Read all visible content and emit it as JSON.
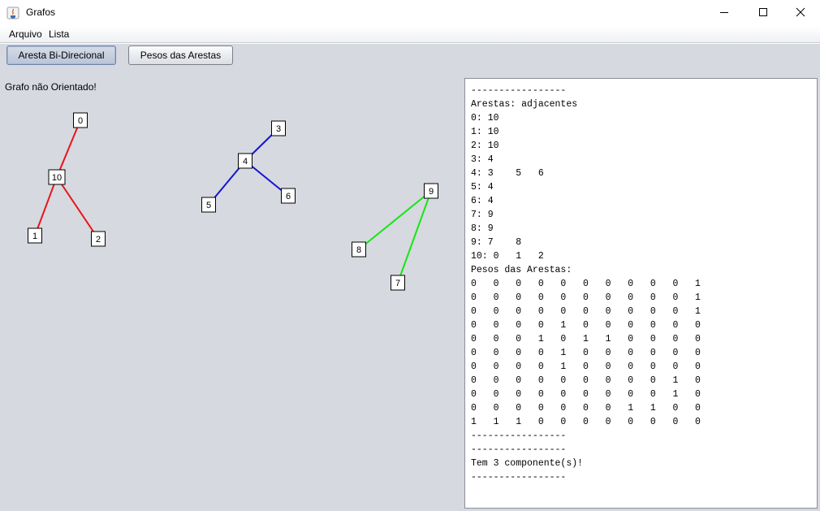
{
  "window": {
    "title": "Grafos"
  },
  "menu": {
    "items": [
      "Arquivo",
      "Lista"
    ]
  },
  "toolbar": {
    "bidirectional_label": "Aresta Bi-Direcional",
    "weights_label": "Pesos das Arestas",
    "bidirectional_selected": true
  },
  "graph": {
    "status_text": "Grafo não Orientado!",
    "nodes": [
      "0",
      "1",
      "2",
      "3",
      "4",
      "5",
      "6",
      "7",
      "8",
      "9",
      "10"
    ],
    "edges": [
      {
        "from": "0",
        "to": "10",
        "component": 0
      },
      {
        "from": "10",
        "to": "1",
        "component": 0
      },
      {
        "from": "10",
        "to": "2",
        "component": 0
      },
      {
        "from": "4",
        "to": "3",
        "component": 1
      },
      {
        "from": "4",
        "to": "5",
        "component": 1
      },
      {
        "from": "4",
        "to": "6",
        "component": 1
      },
      {
        "from": "9",
        "to": "8",
        "component": 2
      },
      {
        "from": "9",
        "to": "7",
        "component": 2
      }
    ],
    "component_colors": [
      "#e8141b",
      "#1414d2",
      "#14e614"
    ]
  },
  "output": {
    "lines": [
      "-----------------",
      "Arestas: adjacentes",
      "0: 10",
      "1: 10",
      "2: 10",
      "3: 4",
      "4: 3    5   6",
      "5: 4",
      "6: 4",
      "7: 9",
      "8: 9",
      "9: 7    8",
      "10: 0   1   2",
      "Pesos das Arestas:",
      "0   0   0   0   0   0   0   0   0   0   1",
      "0   0   0   0   0   0   0   0   0   0   1",
      "0   0   0   0   0   0   0   0   0   0   1",
      "0   0   0   0   1   0   0   0   0   0   0",
      "0   0   0   1   0   1   1   0   0   0   0",
      "0   0   0   0   1   0   0   0   0   0   0",
      "0   0   0   0   1   0   0   0   0   0   0",
      "0   0   0   0   0   0   0   0   0   1   0",
      "0   0   0   0   0   0   0   0   0   1   0",
      "0   0   0   0   0   0   0   1   1   0   0",
      "1   1   1   0   0   0   0   0   0   0   0",
      "-----------------",
      "-----------------",
      "Tem 3 componente(s)!",
      "-----------------"
    ]
  }
}
